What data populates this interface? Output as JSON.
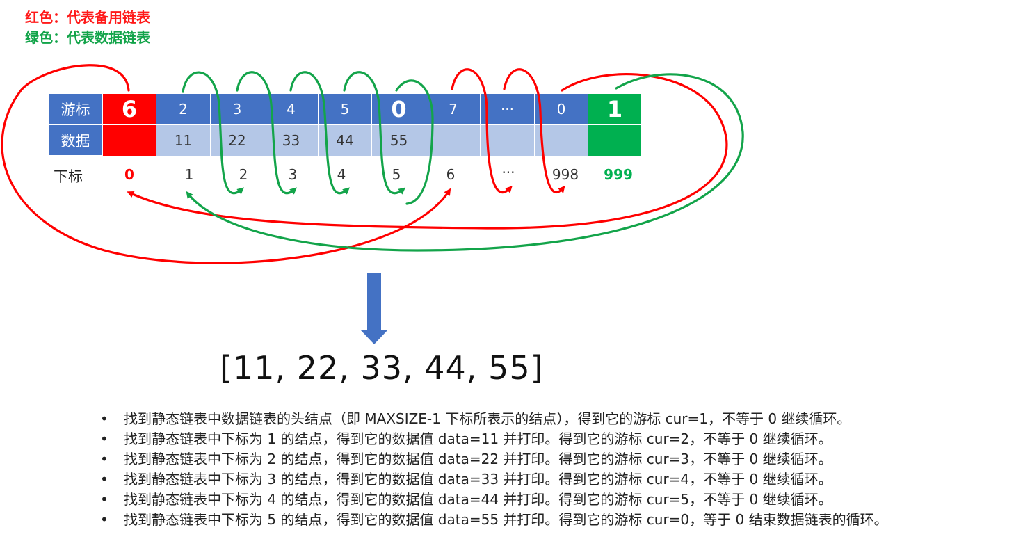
{
  "legend": {
    "red": "红色：代表备用链表",
    "green": "绿色：代表数据链表"
  },
  "colors": {
    "header_blue": "#4472c4",
    "data_light_blue": "#b4c7e7",
    "spare_red": "#ff0000",
    "data_green": "#00b050",
    "arrow_blue": "#4472c4"
  },
  "table": {
    "cursor_label": "游标",
    "data_label": "数据",
    "index_label": "下标",
    "cursors": [
      "6",
      "2",
      "3",
      "4",
      "5",
      "0",
      "7",
      "···",
      "0",
      "1"
    ],
    "data": [
      "",
      "11",
      "22",
      "33",
      "44",
      "55",
      "",
      "",
      "",
      ""
    ],
    "indices": [
      "0",
      "1",
      "2",
      "3",
      "4",
      "5",
      "6",
      "···",
      "998",
      "999"
    ]
  },
  "result": "[11, 22, 33, 44, 55]",
  "steps": [
    "找到静态链表中数据链表的头结点（即 MAXSIZE-1 下标所表示的结点），得到它的游标 cur=1，不等于 0 继续循环。",
    "找到静态链表中下标为 1 的结点，得到它的数据值 data=11 并打印。得到它的游标 cur=2，不等于 0 继续循环。",
    "找到静态链表中下标为 2 的结点，得到它的数据值 data=22 并打印。得到它的游标 cur=3，不等于 0 继续循环。",
    "找到静态链表中下标为 3 的结点，得到它的数据值 data=33 并打印。得到它的游标 cur=4，不等于 0 继续循环。",
    "找到静态链表中下标为 4 的结点，得到它的数据值 data=44 并打印。得到它的游标 cur=5，不等于 0 继续循环。",
    "找到静态链表中下标为 5 的结点，得到它的数据值 data=55 并打印。得到它的游标 cur=0，等于 0 结束数据链表的循环。"
  ]
}
